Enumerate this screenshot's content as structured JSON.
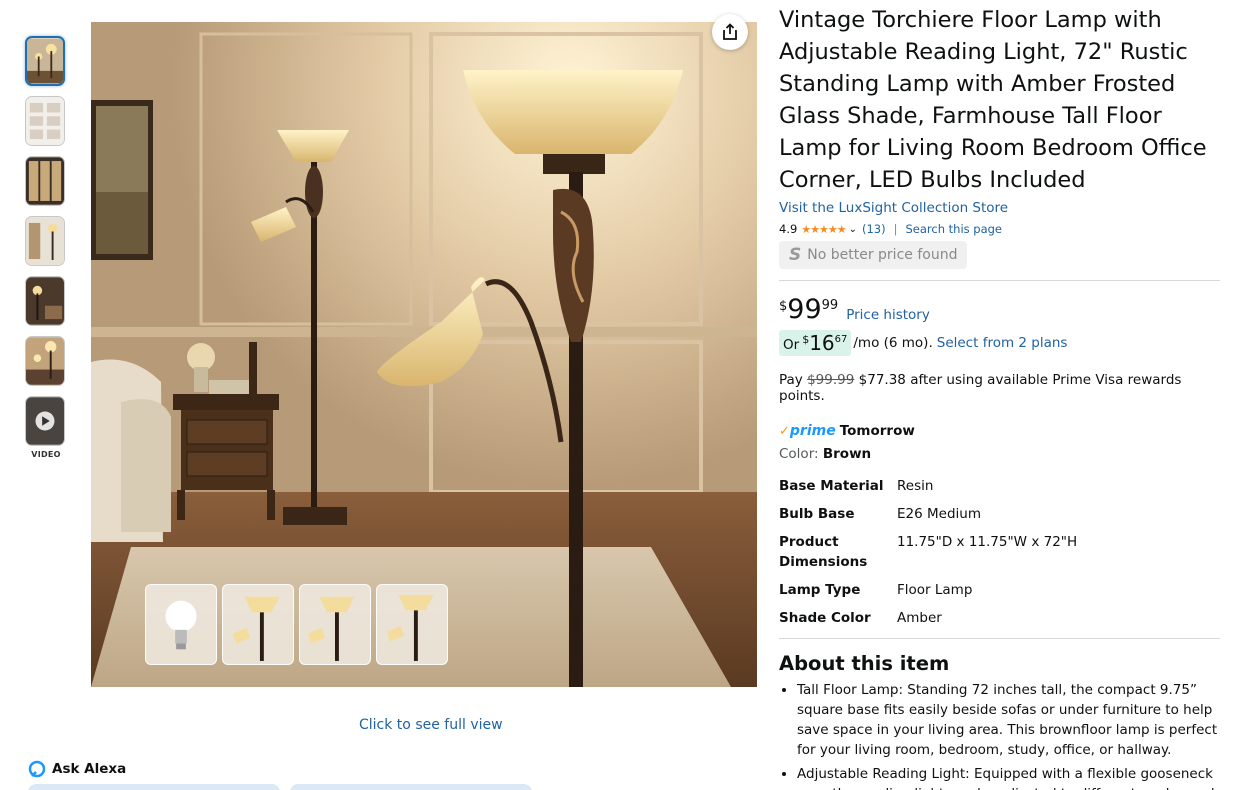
{
  "thumbnails": {
    "count": 7,
    "video_label": "VIDEO"
  },
  "gallery": {
    "full_view_label": "Click to see full view",
    "mini_thumbs": [
      "bulb",
      "lamp-1",
      "lamp-2",
      "lamp-3"
    ]
  },
  "alexa": {
    "label": "Ask Alexa"
  },
  "product": {
    "title": "Vintage Torchiere Floor Lamp with Adjustable Reading Light, 72\" Rustic Standing Lamp with Amber Frosted Glass Shade, Farmhouse Tall Floor Lamp for Living Room Bedroom Office Corner, LED Bulbs Included",
    "store_link": "Visit the LuxSight Collection Store",
    "rating": "4.9",
    "stars": 4.9,
    "review_count": "(13)",
    "search_page": "Search this page",
    "no_better_price": "No better price found",
    "price": {
      "symbol": "$",
      "whole": "99",
      "fraction": "99"
    },
    "price_history": "Price history",
    "monthly": {
      "or": "Or",
      "symbol": "$",
      "whole": "16",
      "fraction": "67",
      "term": "/mo (6 mo).",
      "plans_link": "Select from 2 plans"
    },
    "pay": {
      "prefix": "Pay",
      "old_price": "$99.99",
      "new_price": "$77.38",
      "suffix": "after using available Prime Visa rewards points."
    },
    "prime": {
      "logo": "prime",
      "delivery": "Tomorrow"
    },
    "color": {
      "label": "Color:",
      "value": "Brown"
    },
    "specs": [
      {
        "key": "Base Material",
        "value": "Resin"
      },
      {
        "key": "Bulb Base",
        "value": "E26 Medium"
      },
      {
        "key": "Product Dimensions",
        "value": "11.75\"D x 11.75\"W x 72\"H"
      },
      {
        "key": "Lamp Type",
        "value": "Floor Lamp"
      },
      {
        "key": "Shade Color",
        "value": "Amber"
      }
    ],
    "about_title": "About this item",
    "bullets": [
      "Tall Floor Lamp: Standing 72 inches tall, the compact 9.75” square base fits easily beside sofas or under furniture to help save space in your living area. This brownfloor lamp is perfect for your living room, bedroom, study, office, or hallway.",
      "Adjustable Reading Light: Equipped with a flexible gooseneck arm, the reading light can be adjusted to different angles and heights."
    ]
  },
  "colors": {
    "link": "#2162a1",
    "star": "#f68b1e",
    "prime": "#1a98ff",
    "emi_bg": "#d9f2ea"
  }
}
